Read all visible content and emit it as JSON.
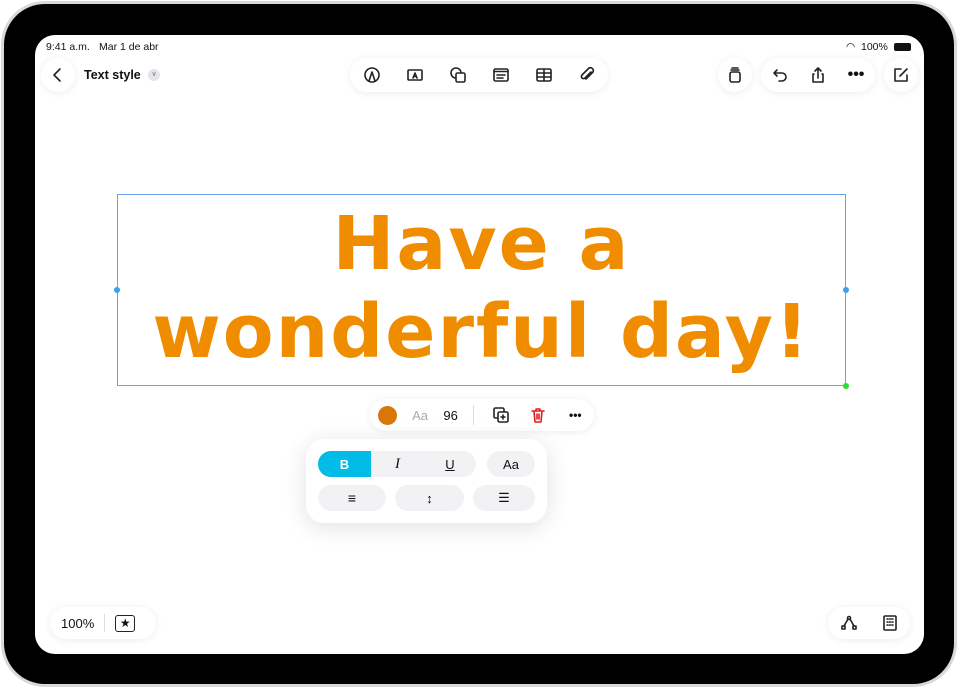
{
  "status": {
    "time": "9:41 a.m.",
    "date": "Mar 1 de abr",
    "battery": "100%"
  },
  "header": {
    "title": "Text style"
  },
  "toolbar": {
    "icons": [
      "pen-circle-icon",
      "text-box-icon",
      "shapes-icon",
      "media-icon",
      "table-icon",
      "paperclip-icon"
    ]
  },
  "canvas": {
    "line1": "Have a",
    "line2": "wonderful day!",
    "text_color": "#EF8C00"
  },
  "text_popover": {
    "color": "#D97706",
    "font_label": "Aa",
    "size": "96"
  },
  "style_panel": {
    "bold": "B",
    "italic": "I",
    "underline": "U",
    "case": "Aa",
    "bold_active": true,
    "accent": "#00BCE6"
  },
  "bottom": {
    "zoom": "100%"
  }
}
